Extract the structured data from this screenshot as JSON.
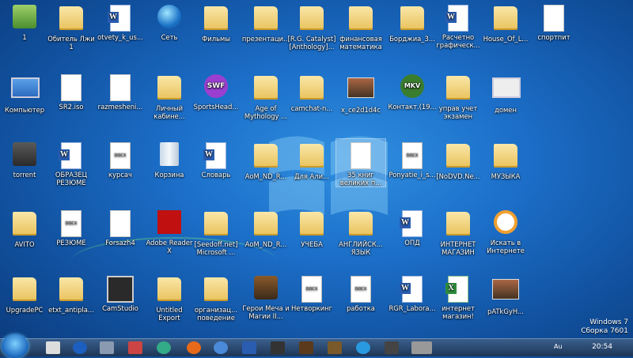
{
  "desktop": {
    "row1": [
      "1",
      "Обитель Лжи 1",
      "otvety_k_us...",
      "Сеть",
      "Фильмы",
      "презентаци...",
      "[R.G. Catalyst] [Anthology]...",
      "финансовая математика",
      "Борджиа_3...",
      "Расчетно графическ...",
      "House_Of_L...",
      "спортпит"
    ],
    "row2": [
      "Компьютер",
      "SR2.iso",
      "razmesheni...",
      "Личный кабине...",
      "SportsHead...",
      "Age of Mythology ...",
      "camchat-n...",
      "x_ce2d1d4c",
      "Контакт.(19...",
      "управ учет экзамен",
      "домен"
    ],
    "row3": [
      "torrent",
      "ОБРАЗЕЦ РЕЗЮМЕ",
      "курсач",
      "Корзина",
      "Словарь",
      "AoM_ND_R...",
      "Для Али...",
      "35 книг великих п...",
      "Ponyatie_i_s...",
      "[NoDVD.Ne...",
      "МУЗЫКА"
    ],
    "row4": [
      "AVITO",
      "РЕЗЮМЕ",
      "Forsazh4",
      "Adobe Reader X",
      "[Seedoff.net] Microsoft ...",
      "AoM_ND_R...",
      "УЧЕБА",
      "АНГЛИЙСК... ЯЗЫК",
      "ОПД",
      "ИНТЕРНЕТ МАГАЗИН",
      "Искать в Интернете"
    ],
    "row5": [
      "UpgradePC",
      "etxt_antipla...",
      "CamStudio",
      "Untitled Export",
      "организац... поведение",
      "Герои Меча и Магии II...",
      "Нетворкинг",
      "работка",
      "RGR_Labora...",
      "интернет магазин!",
      "pATkGyH..."
    ]
  },
  "watermark": {
    "line1": "Windows 7",
    "line2": "Сборка 7601"
  },
  "taskbar": {
    "clock": "20:54",
    "language": "Au"
  },
  "colors": {
    "accent": "#1c6fc9"
  }
}
